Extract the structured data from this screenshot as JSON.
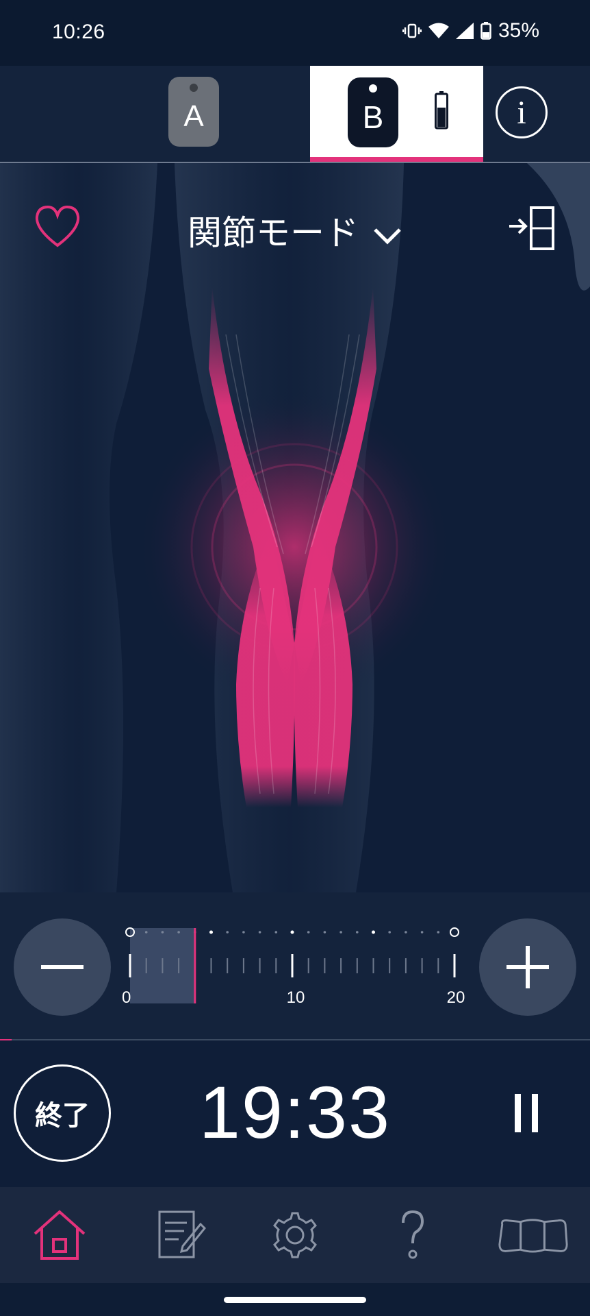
{
  "status_bar": {
    "time": "10:26",
    "battery": "35%"
  },
  "devices": {
    "a_label": "A",
    "b_label": "B",
    "selected": "B",
    "info_icon": "info-icon"
  },
  "main": {
    "mode_title": "関節モード"
  },
  "slider": {
    "scale_min": "0",
    "scale_mid": "10",
    "scale_max": "20",
    "level": 4
  },
  "controls": {
    "end_label": "終了",
    "timer": "19:33",
    "progress": 0.02
  },
  "nav": {
    "items": [
      "home-icon",
      "record-icon",
      "settings-icon",
      "help-icon",
      "pads-icon"
    ],
    "active": "home"
  },
  "colors": {
    "accent": "#e3327b",
    "background": "#0f1e38"
  }
}
